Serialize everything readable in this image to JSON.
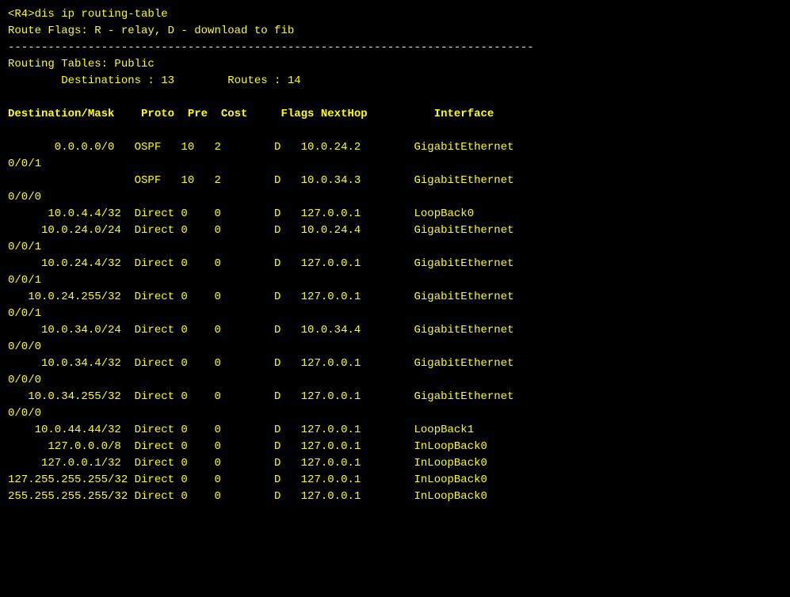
{
  "terminal": {
    "prompt_line": "<R4>dis ip routing-table",
    "route_flags": "Route Flags: R - relay, D - download to fib",
    "separator": "-------------------------------------------------------------------------------",
    "routing_tables_label": "Routing Tables: Public",
    "destinations_label": "        Destinations : 13        Routes : 14",
    "blank1": "",
    "col_header": "Destination/Mask    Proto  Pre  Cost     Flags NextHop          Interface",
    "blank2": "",
    "rows": [
      {
        "destination": "       0.0.0.0/0",
        "proto": "OSPF",
        "pre": "10",
        "cost": "2",
        "flags": "D",
        "nexthop": "10.0.24.2",
        "interface": "GigabitEthernet",
        "continuation": "0/0/1"
      },
      {
        "destination": "                 ",
        "proto": "OSPF",
        "pre": "10",
        "cost": "2",
        "flags": "D",
        "nexthop": "10.0.34.3",
        "interface": "GigabitEthernet",
        "continuation": "0/0/0"
      },
      {
        "destination": "      10.0.4.4/32",
        "proto": "Direct",
        "pre": "0",
        "cost": "0",
        "flags": "D",
        "nexthop": "127.0.0.1",
        "interface": "LoopBack0",
        "continuation": null
      },
      {
        "destination": "     10.0.24.0/24",
        "proto": "Direct",
        "pre": "0",
        "cost": "0",
        "flags": "D",
        "nexthop": "10.0.24.4",
        "interface": "GigabitEthernet",
        "continuation": "0/0/1"
      },
      {
        "destination": "     10.0.24.4/32",
        "proto": "Direct",
        "pre": "0",
        "cost": "0",
        "flags": "D",
        "nexthop": "127.0.0.1",
        "interface": "GigabitEthernet",
        "continuation": "0/0/1"
      },
      {
        "destination": "   10.0.24.255/32",
        "proto": "Direct",
        "pre": "0",
        "cost": "0",
        "flags": "D",
        "nexthop": "127.0.0.1",
        "interface": "GigabitEthernet",
        "continuation": "0/0/1"
      },
      {
        "destination": "     10.0.34.0/24",
        "proto": "Direct",
        "pre": "0",
        "cost": "0",
        "flags": "D",
        "nexthop": "10.0.34.4",
        "interface": "GigabitEthernet",
        "continuation": "0/0/0"
      },
      {
        "destination": "     10.0.34.4/32",
        "proto": "Direct",
        "pre": "0",
        "cost": "0",
        "flags": "D",
        "nexthop": "127.0.0.1",
        "interface": "GigabitEthernet",
        "continuation": "0/0/0"
      },
      {
        "destination": "   10.0.34.255/32",
        "proto": "Direct",
        "pre": "0",
        "cost": "0",
        "flags": "D",
        "nexthop": "127.0.0.1",
        "interface": "GigabitEthernet",
        "continuation": "0/0/0"
      },
      {
        "destination": "    10.0.44.44/32",
        "proto": "Direct",
        "pre": "0",
        "cost": "0",
        "flags": "D",
        "nexthop": "127.0.0.1",
        "interface": "LoopBack1",
        "continuation": null
      },
      {
        "destination": "      127.0.0.0/8",
        "proto": "Direct",
        "pre": "0",
        "cost": "0",
        "flags": "D",
        "nexthop": "127.0.0.1",
        "interface": "InLoopBack0",
        "continuation": null
      },
      {
        "destination": "     127.0.0.1/32",
        "proto": "Direct",
        "pre": "0",
        "cost": "0",
        "flags": "D",
        "nexthop": "127.0.0.1",
        "interface": "InLoopBack0",
        "continuation": null
      },
      {
        "destination": "127.255.255.255/32",
        "proto": "Direct",
        "pre": "0",
        "cost": "0",
        "flags": "D",
        "nexthop": "127.0.0.1",
        "interface": "InLoopBack0",
        "continuation": null
      },
      {
        "destination": "255.255.255.255/32",
        "proto": "Direct",
        "pre": "0",
        "cost": "0",
        "flags": "D",
        "nexthop": "127.0.0.1",
        "interface": "InLoopBack0",
        "continuation": null
      }
    ]
  }
}
